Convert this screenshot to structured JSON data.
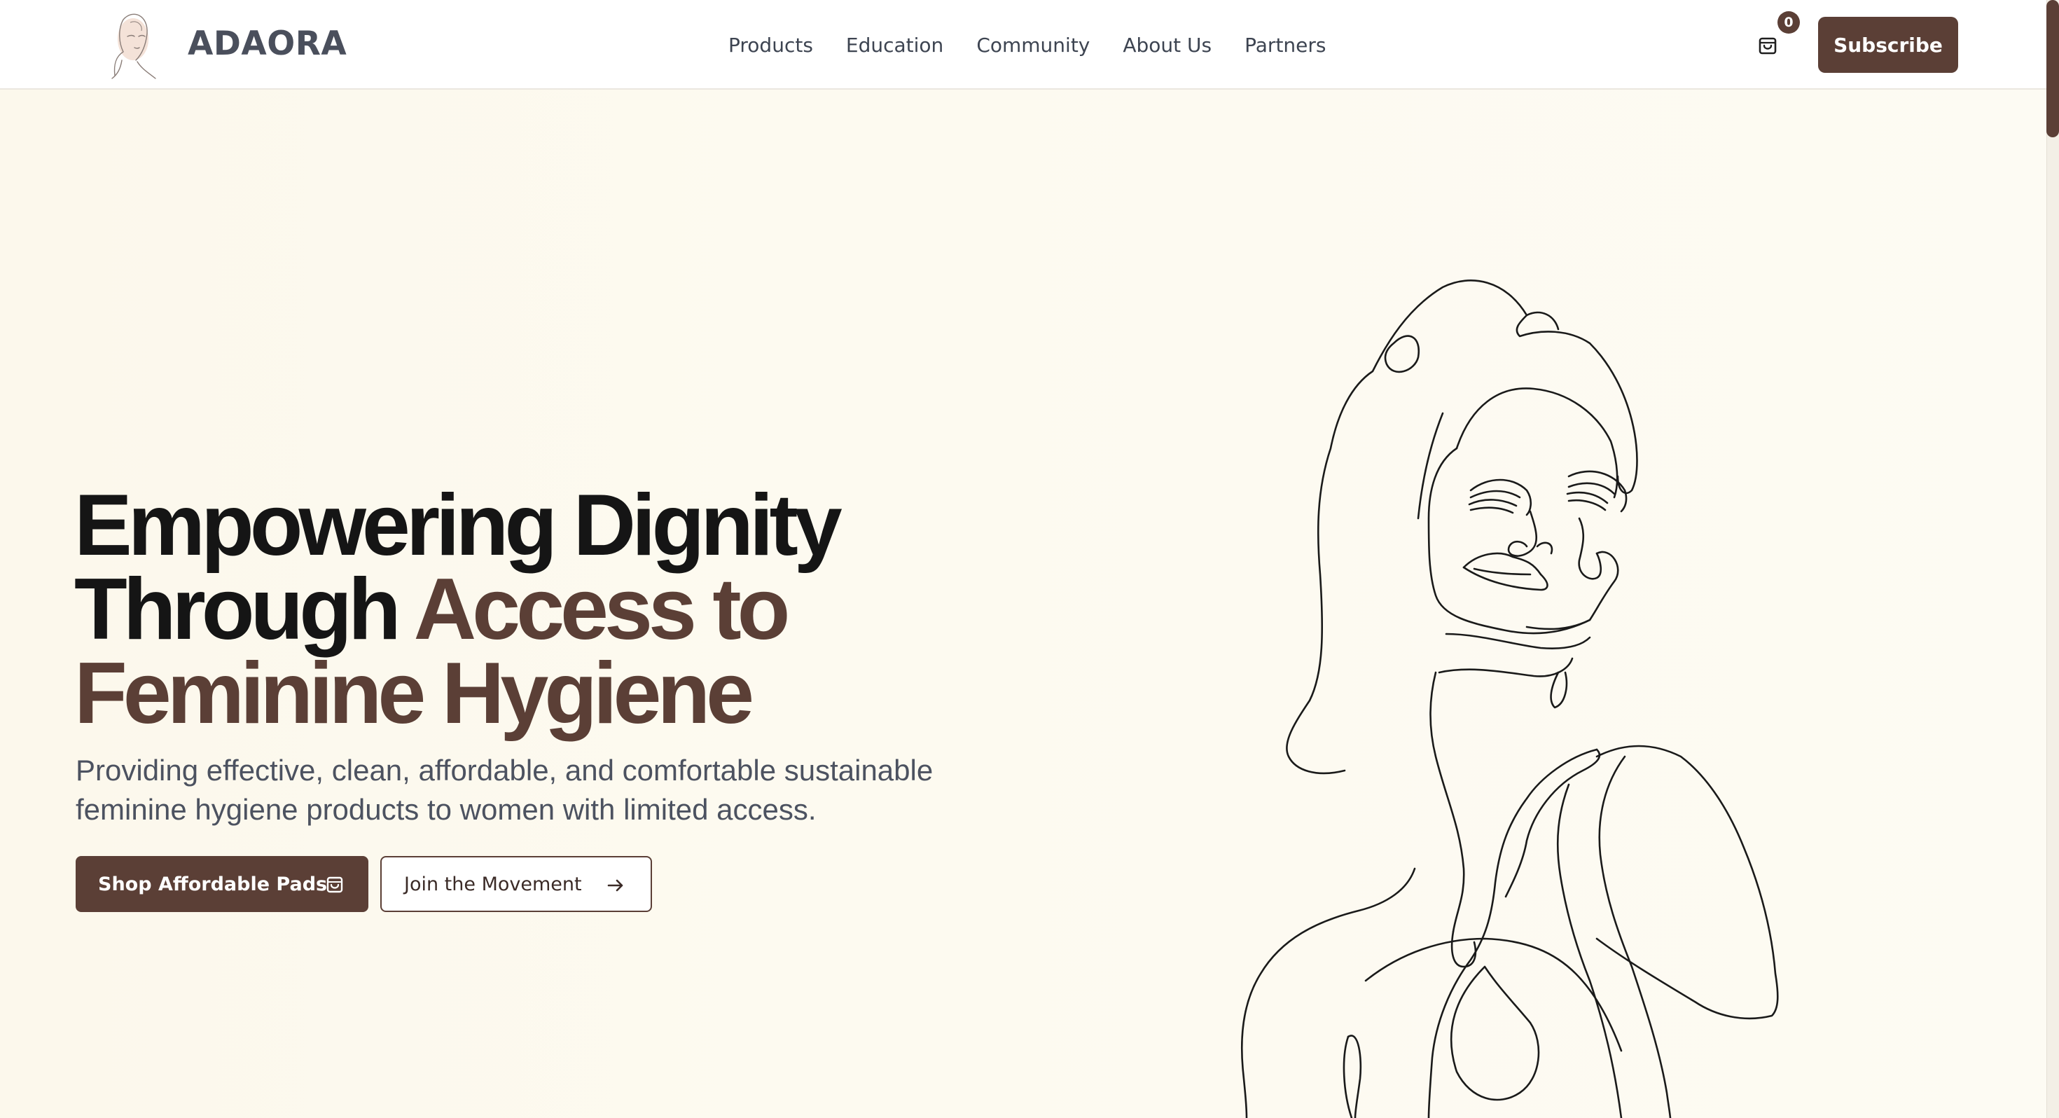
{
  "header": {
    "brand": "ADAORA",
    "logo_icon": "woman-sketch-logo",
    "nav": [
      {
        "label": "Products"
      },
      {
        "label": "Education"
      },
      {
        "label": "Community"
      },
      {
        "label": "About Us"
      },
      {
        "label": "Partners"
      }
    ],
    "cart": {
      "icon": "shopping-bag-icon",
      "count": "0"
    },
    "subscribe_label": "Subscribe"
  },
  "hero": {
    "headline": {
      "line1": "Empowering Dignity",
      "line2_dark": "Through ",
      "line2_accent": "Access to",
      "line3_accent": "Feminine Hygiene"
    },
    "subtext": "Providing effective, clean, affordable, and comfortable sustainable feminine hygiene products to women with limited access.",
    "primary_cta": {
      "label": "Shop Affordable Pads",
      "icon": "shopping-bag-icon"
    },
    "secondary_cta": {
      "label": "Join the Movement",
      "icon": "arrow-right-icon"
    },
    "illustration": "woman-line-art"
  },
  "colors": {
    "brand": "#5b3f36",
    "background": "#fdfaf0",
    "heading": "#151515",
    "body_text": "#4c5260"
  }
}
